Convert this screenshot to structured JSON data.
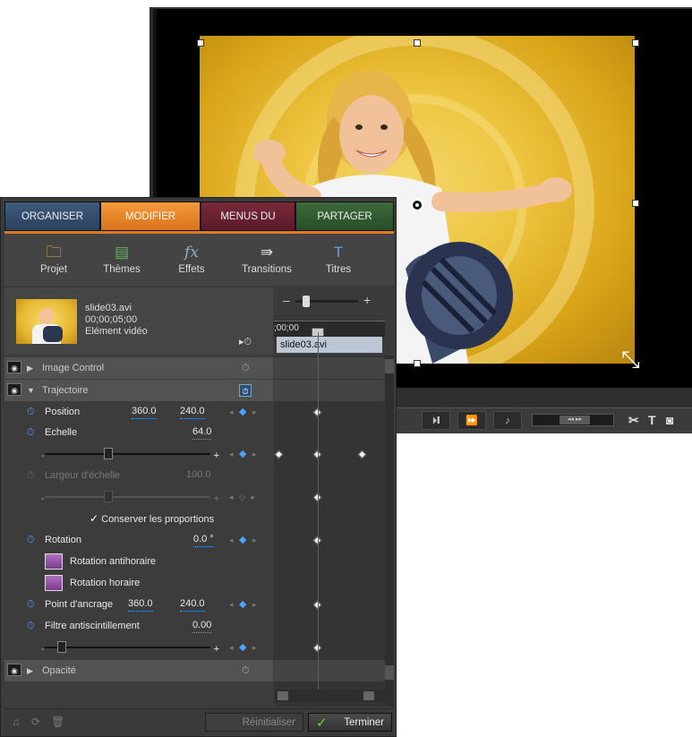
{
  "tabs": [
    "ORGANISER",
    "MODIFIER",
    "MENUS DU DISQUE",
    "PARTAGER"
  ],
  "tools": [
    {
      "label": "Projet",
      "icon": "folder-icon"
    },
    {
      "label": "Thèmes",
      "icon": "themes-icon"
    },
    {
      "label": "Effets",
      "icon": "fx-icon"
    },
    {
      "label": "Transitions",
      "icon": "transitions-icon"
    },
    {
      "label": "Titres",
      "icon": "titles-icon"
    }
  ],
  "clip": {
    "name": "slide03.avi",
    "duration": "00;00;05;00",
    "type": "Elément vidéo"
  },
  "timeline": {
    "timecode": ";00;00",
    "clip_label": "slide03.avi",
    "zoom_minus": "–",
    "zoom_plus": "+"
  },
  "properties": {
    "image_control": "Image Control",
    "trajectoire": "Trajectoire",
    "position_label": "Position",
    "position_x": "360.0",
    "position_y": "240.0",
    "echelle_label": "Echelle",
    "echelle_value": "64.0",
    "largeur_label": "Largeur d'échelle",
    "largeur_value": "100.0",
    "conserver_label": "Conserver les proportions",
    "rotation_label": "Rotation",
    "rotation_value": "0.0 °",
    "rot_anti": "Rotation antihoraire",
    "rot_horaire": "Rotation horaire",
    "ancrage_label": "Point d'ancrage",
    "ancrage_x": "360.0",
    "ancrage_y": "240.0",
    "filtre_label": "Filtre antiscintillement",
    "filtre_value": "0.00",
    "opacite": "Opacité",
    "slider_minus": "-",
    "slider_plus": "+"
  },
  "buttons": {
    "reset": "Réinitialiser",
    "done": "Terminer"
  },
  "colors": {
    "accent": "#e07a1f",
    "keyframe_blue": "#4aa3ff",
    "playhead": "#d62a2a",
    "done_check": "#6ed04a"
  }
}
